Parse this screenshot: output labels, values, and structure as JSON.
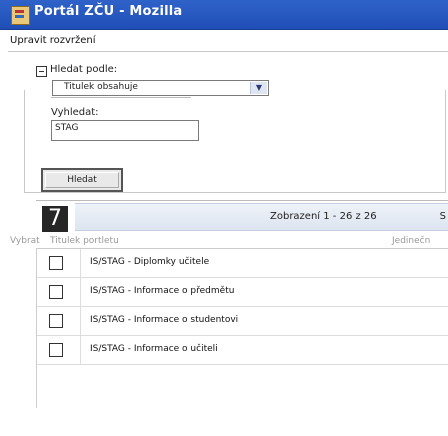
{
  "window": {
    "title": "Portál ZČU - Mozilla"
  },
  "page": {
    "heading": "Upravit rozvržení"
  },
  "search": {
    "legend": "Hledat podle:",
    "select_value": "Titulek obsahuje",
    "search_label": "Vyhledat:",
    "search_value": "STAG",
    "submit_label": "Hledat"
  },
  "results": {
    "badge": "7",
    "summary": "Zobrazení 1 - 26 z 26",
    "summary_extra": "S",
    "columns": {
      "select": "Vybrat",
      "title": "Titulek portletu",
      "unique": "Jedinečn"
    },
    "rows": [
      {
        "label": "IS/STAG - Diplomky učitele"
      },
      {
        "label": "IS/STAG - Informace o předmětu"
      },
      {
        "label": "IS/STAG - Informace o studentovi"
      },
      {
        "label": "IS/STAG - Informace o učiteli"
      }
    ]
  }
}
